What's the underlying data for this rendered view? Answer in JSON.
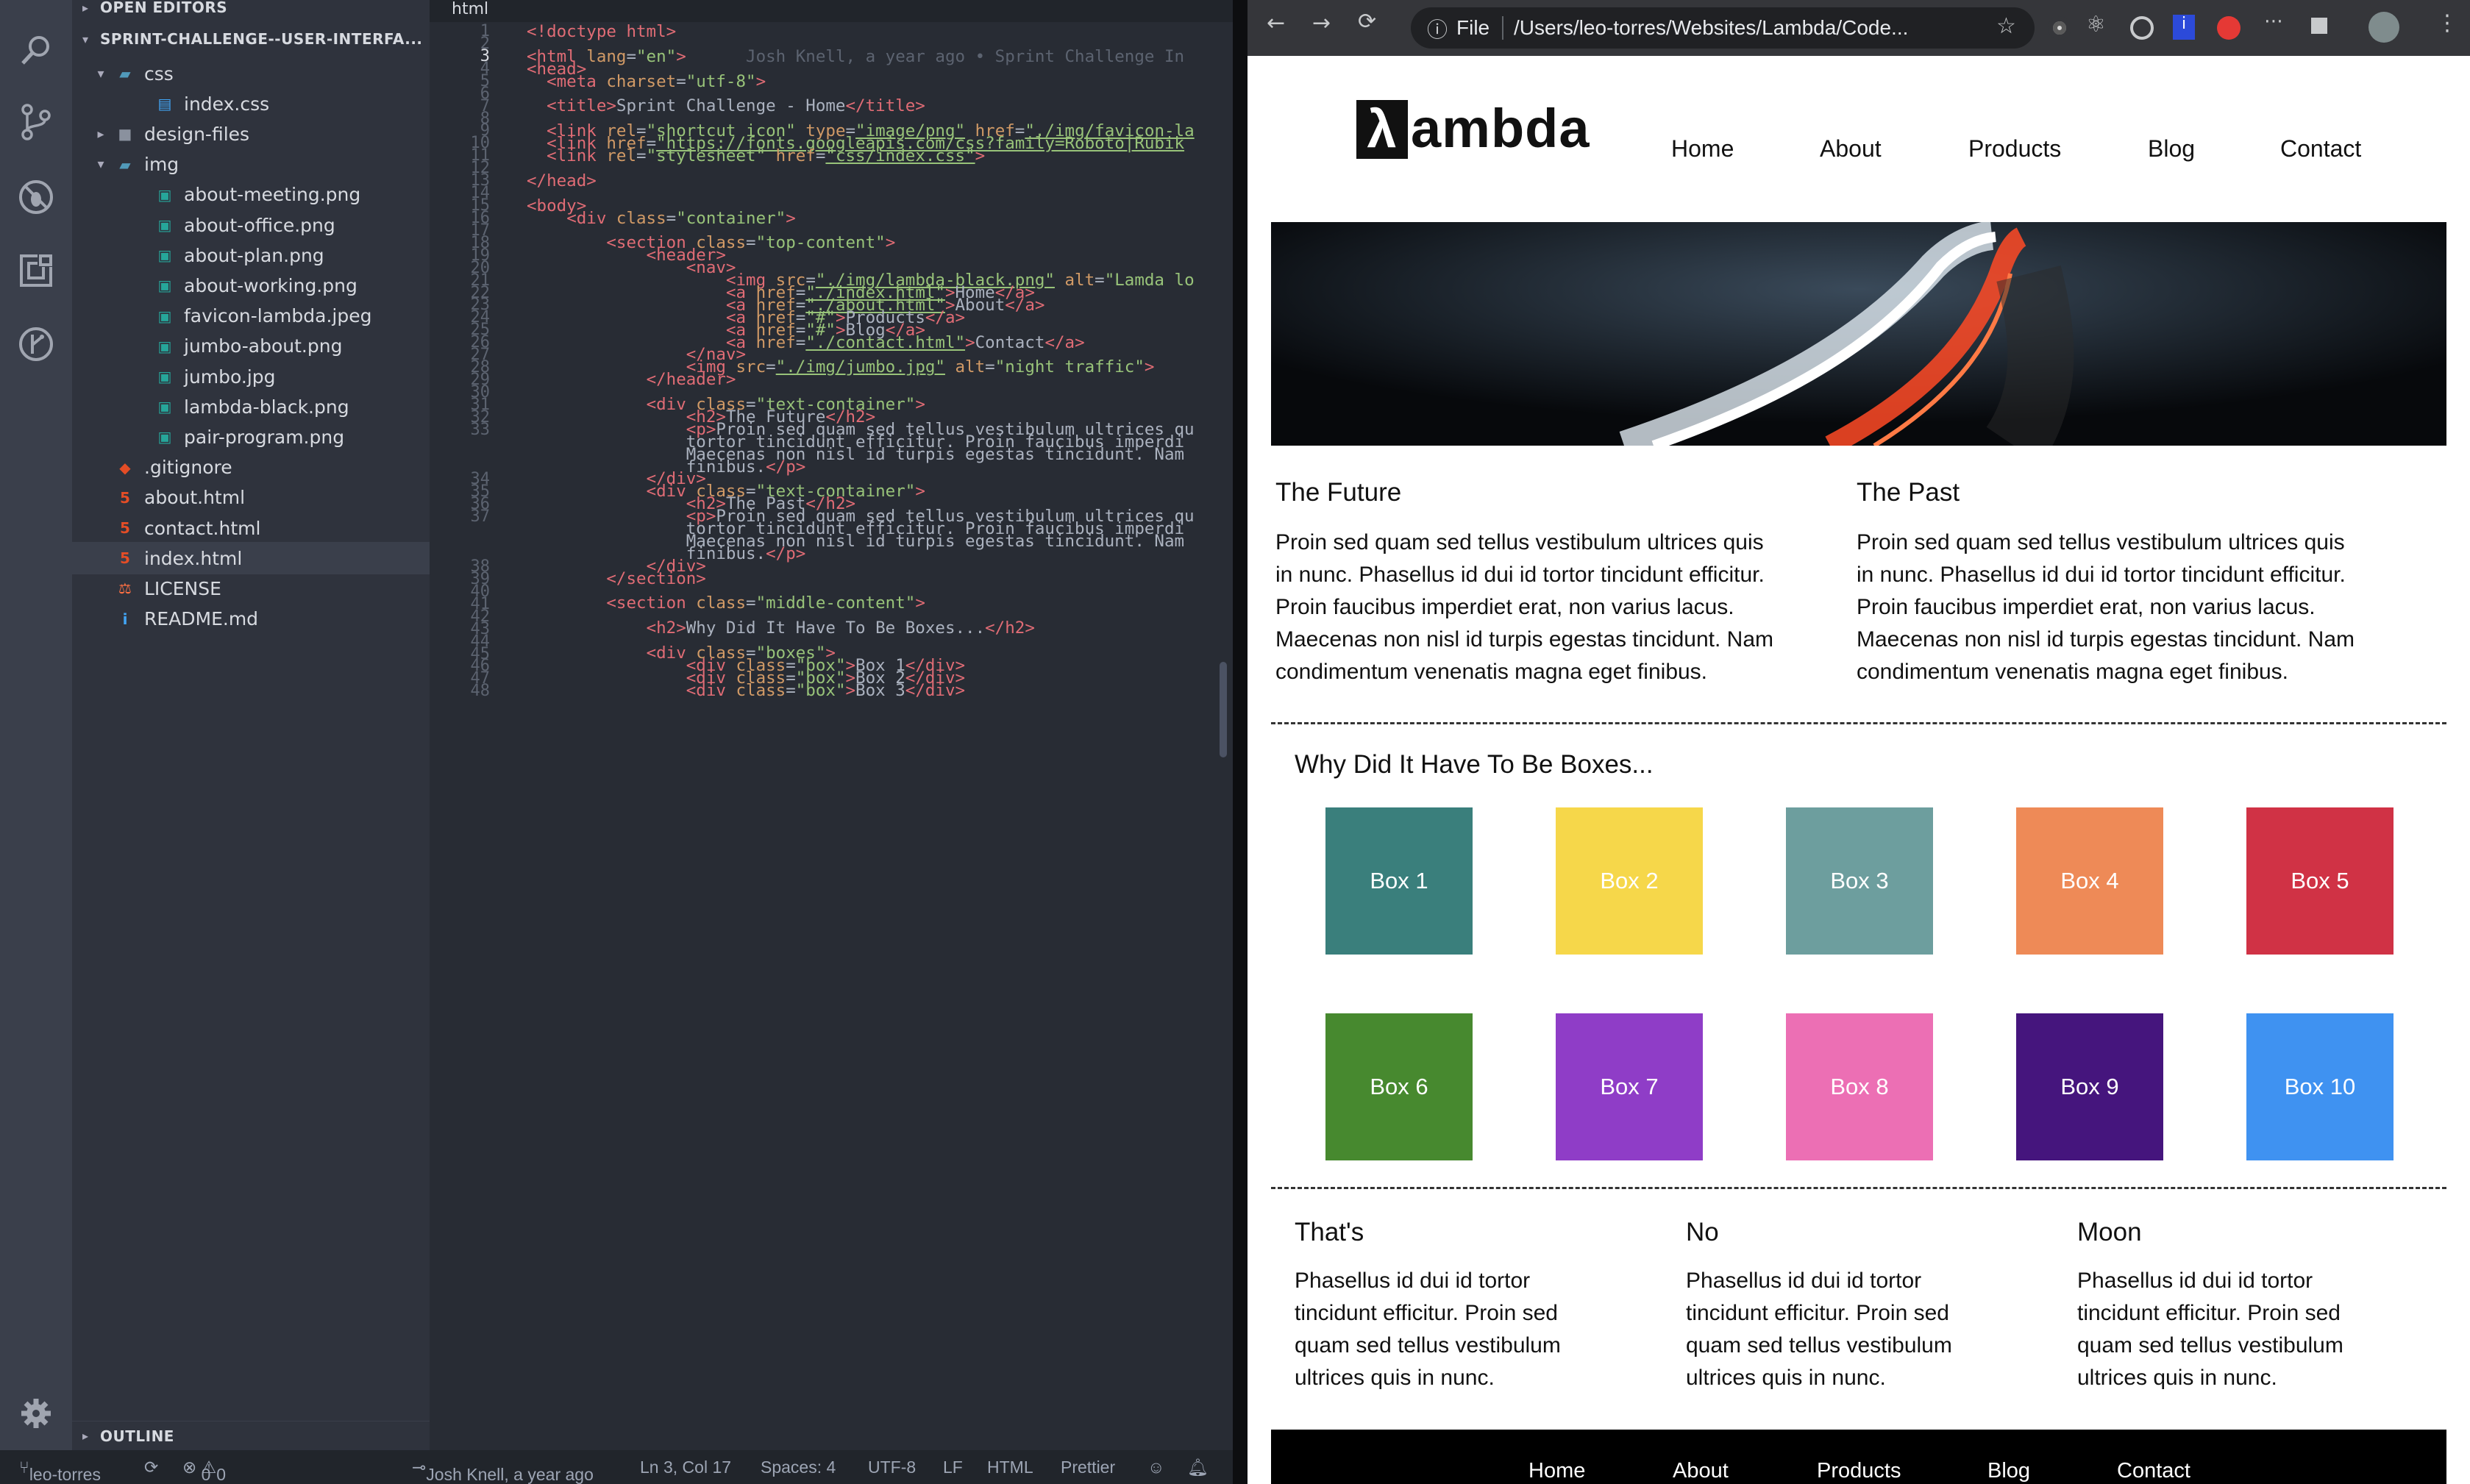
{
  "vscode": {
    "tab": "html",
    "sections": {
      "open_editors": "OPEN EDITORS",
      "project": "SPRINT-CHALLENGE--USER-INTERFA...",
      "outline": "OUTLINE"
    },
    "tree": [
      {
        "label": "css",
        "kind": "folder-open",
        "depth": 1
      },
      {
        "label": "index.css",
        "kind": "css",
        "depth": 2
      },
      {
        "label": "design-files",
        "kind": "folder",
        "depth": 1
      },
      {
        "label": "img",
        "kind": "folder-open",
        "depth": 1
      },
      {
        "label": "about-meeting.png",
        "kind": "image",
        "depth": 2
      },
      {
        "label": "about-office.png",
        "kind": "image",
        "depth": 2
      },
      {
        "label": "about-plan.png",
        "kind": "image",
        "depth": 2
      },
      {
        "label": "about-working.png",
        "kind": "image",
        "depth": 2
      },
      {
        "label": "favicon-lambda.jpeg",
        "kind": "image",
        "depth": 2
      },
      {
        "label": "jumbo-about.png",
        "kind": "image",
        "depth": 2
      },
      {
        "label": "jumbo.jpg",
        "kind": "image",
        "depth": 2
      },
      {
        "label": "lambda-black.png",
        "kind": "image",
        "depth": 2
      },
      {
        "label": "pair-program.png",
        "kind": "image",
        "depth": 2
      },
      {
        "label": ".gitignore",
        "kind": "git",
        "depth": 1
      },
      {
        "label": "about.html",
        "kind": "html",
        "depth": 1
      },
      {
        "label": "contact.html",
        "kind": "html",
        "depth": 1
      },
      {
        "label": "index.html",
        "kind": "html",
        "depth": 1,
        "selected": true
      },
      {
        "label": "LICENSE",
        "kind": "license",
        "depth": 1
      },
      {
        "label": "README.md",
        "kind": "info",
        "depth": 1
      }
    ],
    "line_numbers": [
      "1",
      "2",
      "3",
      "4",
      "5",
      "6",
      "7",
      "8",
      "9",
      "10",
      "11",
      "12",
      "13",
      "14",
      "15",
      "16",
      "17",
      "18",
      "19",
      "20",
      "21",
      "22",
      "23",
      "24",
      "25",
      "26",
      "27",
      "28",
      "29",
      "30",
      "31",
      "32",
      "33",
      "",
      "",
      "",
      "34",
      "35",
      "36",
      "37",
      "",
      "",
      "",
      "38",
      "39",
      "40",
      "41",
      "42",
      "43",
      "44",
      "45",
      "46",
      "47",
      "48"
    ],
    "code_lines": [
      [
        [
          "tg",
          "<!doctype html>"
        ]
      ],
      [],
      [
        [
          "tg",
          "<html "
        ],
        [
          "at",
          "lang"
        ],
        [
          "pl",
          "="
        ],
        [
          "st",
          "\"en\""
        ],
        [
          "tg",
          ">"
        ],
        [
          "bl",
          "      Josh Knell, a year ago • Sprint Challenge In"
        ]
      ],
      [
        [
          "tg",
          "<head>"
        ]
      ],
      [
        [
          "pl",
          "  "
        ],
        [
          "tg",
          "<meta "
        ],
        [
          "at",
          "charset"
        ],
        [
          "pl",
          "="
        ],
        [
          "st",
          "\"utf-8\""
        ],
        [
          "tg",
          ">"
        ]
      ],
      [],
      [
        [
          "pl",
          "  "
        ],
        [
          "tg",
          "<title>"
        ],
        [
          "pl",
          "Sprint Challenge - Home"
        ],
        [
          "tg",
          "</title>"
        ]
      ],
      [],
      [
        [
          "pl",
          "  "
        ],
        [
          "tg",
          "<link "
        ],
        [
          "at",
          "rel"
        ],
        [
          "pl",
          "="
        ],
        [
          "st",
          "\"shortcut icon\""
        ],
        [
          "pl",
          " "
        ],
        [
          "at",
          "type"
        ],
        [
          "pl",
          "="
        ],
        [
          "st",
          "\"image/png\""
        ],
        [
          "pl",
          " "
        ],
        [
          "at",
          "href"
        ],
        [
          "pl",
          "="
        ],
        [
          "st",
          "\"./img/favicon-la"
        ]
      ],
      [
        [
          "pl",
          "  "
        ],
        [
          "tg",
          "<link "
        ],
        [
          "at",
          "href"
        ],
        [
          "pl",
          "="
        ],
        [
          "st",
          "\"https://fonts.googleapis.com/css?family=Roboto|Rubik"
        ]
      ],
      [
        [
          "pl",
          "  "
        ],
        [
          "tg",
          "<link "
        ],
        [
          "at",
          "rel"
        ],
        [
          "pl",
          "="
        ],
        [
          "st",
          "\"stylesheet\""
        ],
        [
          "pl",
          " "
        ],
        [
          "at",
          "href"
        ],
        [
          "pl",
          "="
        ],
        [
          "st",
          "\"css/index.css\""
        ],
        [
          "tg",
          ">"
        ]
      ],
      [],
      [
        [
          "tg",
          "</head>"
        ]
      ],
      [],
      [
        [
          "tg",
          "<body>"
        ]
      ],
      [
        [
          "pl",
          "    "
        ],
        [
          "tg",
          "<div "
        ],
        [
          "at",
          "class"
        ],
        [
          "pl",
          "="
        ],
        [
          "st",
          "\"container\""
        ],
        [
          "tg",
          ">"
        ]
      ],
      [],
      [
        [
          "pl",
          "        "
        ],
        [
          "tg",
          "<section "
        ],
        [
          "at",
          "class"
        ],
        [
          "pl",
          "="
        ],
        [
          "st",
          "\"top-content\""
        ],
        [
          "tg",
          ">"
        ]
      ],
      [
        [
          "pl",
          "            "
        ],
        [
          "tg",
          "<header>"
        ]
      ],
      [
        [
          "pl",
          "                "
        ],
        [
          "tg",
          "<nav>"
        ]
      ],
      [
        [
          "pl",
          "                    "
        ],
        [
          "tg",
          "<img "
        ],
        [
          "at",
          "src"
        ],
        [
          "pl",
          "="
        ],
        [
          "st",
          "\"./img/lambda-black.png\""
        ],
        [
          "pl",
          " "
        ],
        [
          "at",
          "alt"
        ],
        [
          "pl",
          "="
        ],
        [
          "st",
          "\"Lamda lo"
        ]
      ],
      [
        [
          "pl",
          "                    "
        ],
        [
          "tg",
          "<a "
        ],
        [
          "at",
          "href"
        ],
        [
          "pl",
          "="
        ],
        [
          "st",
          "\"./index.html\""
        ],
        [
          "tg",
          ">"
        ],
        [
          "pl",
          "Home"
        ],
        [
          "tg",
          "</a>"
        ]
      ],
      [
        [
          "pl",
          "                    "
        ],
        [
          "tg",
          "<a "
        ],
        [
          "at",
          "href"
        ],
        [
          "pl",
          "="
        ],
        [
          "st",
          "\"./about.html\""
        ],
        [
          "tg",
          ">"
        ],
        [
          "pl",
          "About"
        ],
        [
          "tg",
          "</a>"
        ]
      ],
      [
        [
          "pl",
          "                    "
        ],
        [
          "tg",
          "<a "
        ],
        [
          "at",
          "href"
        ],
        [
          "pl",
          "="
        ],
        [
          "st",
          "\"#\""
        ],
        [
          "tg",
          ">"
        ],
        [
          "pl",
          "Products"
        ],
        [
          "tg",
          "</a>"
        ]
      ],
      [
        [
          "pl",
          "                    "
        ],
        [
          "tg",
          "<a "
        ],
        [
          "at",
          "href"
        ],
        [
          "pl",
          "="
        ],
        [
          "st",
          "\"#\""
        ],
        [
          "tg",
          ">"
        ],
        [
          "pl",
          "Blog"
        ],
        [
          "tg",
          "</a>"
        ]
      ],
      [
        [
          "pl",
          "                    "
        ],
        [
          "tg",
          "<a "
        ],
        [
          "at",
          "href"
        ],
        [
          "pl",
          "="
        ],
        [
          "st",
          "\"./contact.html\""
        ],
        [
          "tg",
          ">"
        ],
        [
          "pl",
          "Contact"
        ],
        [
          "tg",
          "</a>"
        ]
      ],
      [
        [
          "pl",
          "                "
        ],
        [
          "tg",
          "</nav>"
        ]
      ],
      [
        [
          "pl",
          "                "
        ],
        [
          "tg",
          "<img "
        ],
        [
          "at",
          "src"
        ],
        [
          "pl",
          "="
        ],
        [
          "st",
          "\"./img/jumbo.jpg\""
        ],
        [
          "pl",
          " "
        ],
        [
          "at",
          "alt"
        ],
        [
          "pl",
          "="
        ],
        [
          "st",
          "\"night traffic\""
        ],
        [
          "tg",
          ">"
        ]
      ],
      [
        [
          "pl",
          "            "
        ],
        [
          "tg",
          "</header>"
        ]
      ],
      [],
      [
        [
          "pl",
          "            "
        ],
        [
          "tg",
          "<div "
        ],
        [
          "at",
          "class"
        ],
        [
          "pl",
          "="
        ],
        [
          "st",
          "\"text-container\""
        ],
        [
          "tg",
          ">"
        ]
      ],
      [
        [
          "pl",
          "                "
        ],
        [
          "tg",
          "<h2>"
        ],
        [
          "pl",
          "The Future"
        ],
        [
          "tg",
          "</h2>"
        ]
      ],
      [
        [
          "pl",
          "                "
        ],
        [
          "tg",
          "<p>"
        ],
        [
          "pl",
          "Proin sed quam sed tellus vestibulum ultrices qu"
        ]
      ],
      [
        [
          "pl",
          "                tortor tincidunt efficitur. Proin faucibus imperdi"
        ]
      ],
      [
        [
          "pl",
          "                Maecenas non nisl id turpis egestas tincidunt. Nam"
        ]
      ],
      [
        [
          "pl",
          "                finibus."
        ],
        [
          "tg",
          "</p>"
        ]
      ],
      [
        [
          "pl",
          "            "
        ],
        [
          "tg",
          "</div>"
        ]
      ],
      [
        [
          "pl",
          "            "
        ],
        [
          "tg",
          "<div "
        ],
        [
          "at",
          "class"
        ],
        [
          "pl",
          "="
        ],
        [
          "st",
          "\"text-container\""
        ],
        [
          "tg",
          ">"
        ]
      ],
      [
        [
          "pl",
          "                "
        ],
        [
          "tg",
          "<h2>"
        ],
        [
          "pl",
          "The Past"
        ],
        [
          "tg",
          "</h2>"
        ]
      ],
      [
        [
          "pl",
          "                "
        ],
        [
          "tg",
          "<p>"
        ],
        [
          "pl",
          "Proin sed quam sed tellus vestibulum ultrices qu"
        ]
      ],
      [
        [
          "pl",
          "                tortor tincidunt efficitur. Proin faucibus imperdi"
        ]
      ],
      [
        [
          "pl",
          "                Maecenas non nisl id turpis egestas tincidunt. Nam"
        ]
      ],
      [
        [
          "pl",
          "                finibus."
        ],
        [
          "tg",
          "</p>"
        ]
      ],
      [
        [
          "pl",
          "            "
        ],
        [
          "tg",
          "</div>"
        ]
      ],
      [
        [
          "pl",
          "        "
        ],
        [
          "tg",
          "</section>"
        ]
      ],
      [],
      [
        [
          "pl",
          "        "
        ],
        [
          "tg",
          "<section "
        ],
        [
          "at",
          "class"
        ],
        [
          "pl",
          "="
        ],
        [
          "st",
          "\"middle-content\""
        ],
        [
          "tg",
          ">"
        ]
      ],
      [],
      [
        [
          "pl",
          "            "
        ],
        [
          "tg",
          "<h2>"
        ],
        [
          "pl",
          "Why Did It Have To Be Boxes..."
        ],
        [
          "tg",
          "</h2>"
        ]
      ],
      [],
      [
        [
          "pl",
          "            "
        ],
        [
          "tg",
          "<div "
        ],
        [
          "at",
          "class"
        ],
        [
          "pl",
          "="
        ],
        [
          "st",
          "\"boxes\""
        ],
        [
          "tg",
          ">"
        ]
      ],
      [
        [
          "pl",
          "                "
        ],
        [
          "tg",
          "<div "
        ],
        [
          "at",
          "class"
        ],
        [
          "pl",
          "="
        ],
        [
          "st",
          "\"box\""
        ],
        [
          "tg",
          ">"
        ],
        [
          "pl",
          "Box 1"
        ],
        [
          "tg",
          "</div>"
        ]
      ],
      [
        [
          "pl",
          "                "
        ],
        [
          "tg",
          "<div "
        ],
        [
          "at",
          "class"
        ],
        [
          "pl",
          "="
        ],
        [
          "st",
          "\"box\""
        ],
        [
          "tg",
          ">"
        ],
        [
          "pl",
          "Box 2"
        ],
        [
          "tg",
          "</div>"
        ]
      ],
      [
        [
          "pl",
          "                "
        ],
        [
          "tg",
          "<div "
        ],
        [
          "at",
          "class"
        ],
        [
          "pl",
          "="
        ],
        [
          "st",
          "\"box\""
        ],
        [
          "tg",
          ">"
        ],
        [
          "pl",
          "Box 3"
        ],
        [
          "tg",
          "</div>"
        ]
      ]
    ],
    "status": {
      "branch": "leo-torres",
      "errors": "0",
      "warnings": "0",
      "blame": "Josh Knell, a year ago",
      "position": "Ln 3, Col 17",
      "spaces": "Spaces: 4",
      "encoding": "UTF-8",
      "eol": "LF",
      "language": "HTML",
      "formatter": "Prettier"
    }
  },
  "browser": {
    "scheme_label": "File",
    "url": "/Users/leo-torres/Websites/Lambda/Code...",
    "page": {
      "logo_text": "ambda",
      "logo_glyph": "λ",
      "nav": [
        "Home",
        "About",
        "Products",
        "Blog",
        "Contact"
      ],
      "top": [
        {
          "title": "The Future",
          "lines": [
            "Proin sed quam sed tellus vestibulum ultrices quis",
            "in nunc. Phasellus id dui id tortor tincidunt efficitur.",
            "Proin faucibus imperdiet erat, non varius lacus.",
            "Maecenas non nisl id turpis egestas tincidunt. Nam",
            "condimentum venenatis magna eget finibus."
          ]
        },
        {
          "title": "The Past",
          "lines": [
            "Proin sed quam sed tellus vestibulum ultrices quis",
            "in nunc. Phasellus id dui id tortor tincidunt efficitur.",
            "Proin faucibus imperdiet erat, non varius lacus.",
            "Maecenas non nisl id turpis egestas tincidunt. Nam",
            "condimentum venenatis magna eget finibus."
          ]
        }
      ],
      "boxes_title": "Why Did It Have To Be Boxes...",
      "boxes": [
        {
          "label": "Box 1",
          "color": "#3a7f7c"
        },
        {
          "label": "Box 2",
          "color": "#f6d74a"
        },
        {
          "label": "Box 3",
          "color": "#6d9e9e"
        },
        {
          "label": "Box 4",
          "color": "#ee8a57"
        },
        {
          "label": "Box 5",
          "color": "#d03245"
        },
        {
          "label": "Box 6",
          "color": "#47892f"
        },
        {
          "label": "Box 7",
          "color": "#8f3dc7"
        },
        {
          "label": "Box 8",
          "color": "#ec6fb4"
        },
        {
          "label": "Box 9",
          "color": "#45157d"
        },
        {
          "label": "Box 10",
          "color": "#3f92f1"
        }
      ],
      "bottom": [
        {
          "title": "That's",
          "lines": [
            "Phasellus id dui id tortor",
            "tincidunt efficitur. Proin sed",
            "quam sed tellus vestibulum",
            "ultrices quis in nunc."
          ]
        },
        {
          "title": "No",
          "lines": [
            "Phasellus id dui id tortor",
            "tincidunt efficitur. Proin sed",
            "quam sed tellus vestibulum",
            "ultrices quis in nunc."
          ]
        },
        {
          "title": "Moon",
          "lines": [
            "Phasellus id dui id tortor",
            "tincidunt efficitur. Proin sed",
            "quam sed tellus vestibulum",
            "ultrices quis in nunc."
          ]
        }
      ],
      "footer_nav": [
        "Home",
        "About",
        "Products",
        "Blog",
        "Contact"
      ]
    }
  }
}
